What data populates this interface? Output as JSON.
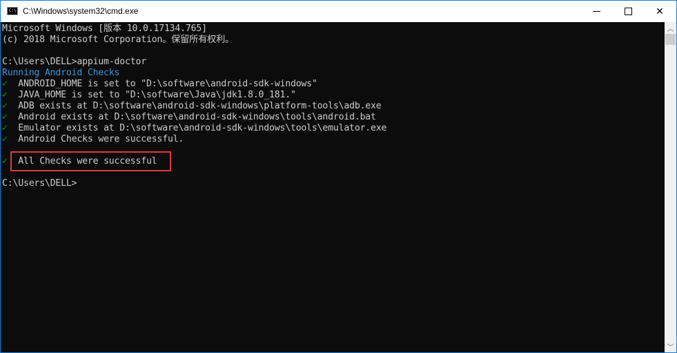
{
  "window": {
    "title": "C:\\Windows\\system32\\cmd.exe",
    "icon_label": "C:\\",
    "controls": {
      "minimize": "minimize-icon",
      "maximize": "maximize-icon",
      "close": "close-icon",
      "close_glyph": "✕"
    }
  },
  "console": {
    "lines": [
      "Microsoft Windows [版本 10.0.17134.765]",
      "(c) 2018 Microsoft Corporation。保留所有权利。",
      "",
      "C:\\Users\\DELL>appium-doctor"
    ],
    "section_header": "Running Android Checks",
    "check_glyph": "✓",
    "checks": [
      "ANDROID_HOME is set to \"D:\\software\\android-sdk-windows\"",
      "JAVA_HOME is set to \"D:\\software\\Java\\jdk1.8.0_181.\"",
      "ADB exists at D:\\software\\android-sdk-windows\\platform-tools\\adb.exe",
      "Android exists at D:\\software\\android-sdk-windows\\tools\\android.bat",
      "Emulator exists at D:\\software\\android-sdk-windows\\tools\\emulator.exe",
      "Android Checks were successful."
    ],
    "final_check": "All Checks were successful",
    "prompt": "C:\\Users\\DELL>"
  },
  "colors": {
    "background": "#0c0c0c",
    "text": "#cccccc",
    "header_blue": "#3a96dd",
    "check_green": "#13a10e",
    "highlight_red": "#e03a3a"
  },
  "scrollbar": {
    "up_glyph": "︿",
    "down_glyph": "﹀"
  }
}
